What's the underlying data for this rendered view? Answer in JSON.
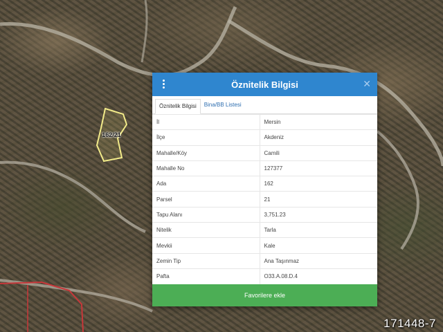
{
  "map": {
    "parcel_label": "162/21",
    "watermark": "171448-7"
  },
  "dialog": {
    "title": "Öznitelik Bilgisi",
    "header_color": "#2f86cf",
    "menu_icon": "vertical-dots-icon",
    "close_icon": "close-icon",
    "tabs": [
      {
        "label": "Öznitelik Bilgisi",
        "active": true
      },
      {
        "label": "Bina/BB Listesi",
        "active": false
      }
    ],
    "rows": [
      {
        "key": "İl",
        "value": "Mersin"
      },
      {
        "key": "İlçe",
        "value": "Akdeniz"
      },
      {
        "key": "Mahalle/Köy",
        "value": "Camili"
      },
      {
        "key": "Mahalle No",
        "value": "127377"
      },
      {
        "key": "Ada",
        "value": "162"
      },
      {
        "key": "Parsel",
        "value": "21"
      },
      {
        "key": "Tapu Alanı",
        "value": "3,751.23"
      },
      {
        "key": "Nitelik",
        "value": "Tarla"
      },
      {
        "key": "Mevkii",
        "value": "Kale"
      },
      {
        "key": "Zemin Tip",
        "value": "Ana Taşınmaz"
      },
      {
        "key": "Pafta",
        "value": "O33.A.08.D.4"
      }
    ],
    "favorite_button": "Favorilere ekle",
    "button_color": "#4cae55"
  }
}
